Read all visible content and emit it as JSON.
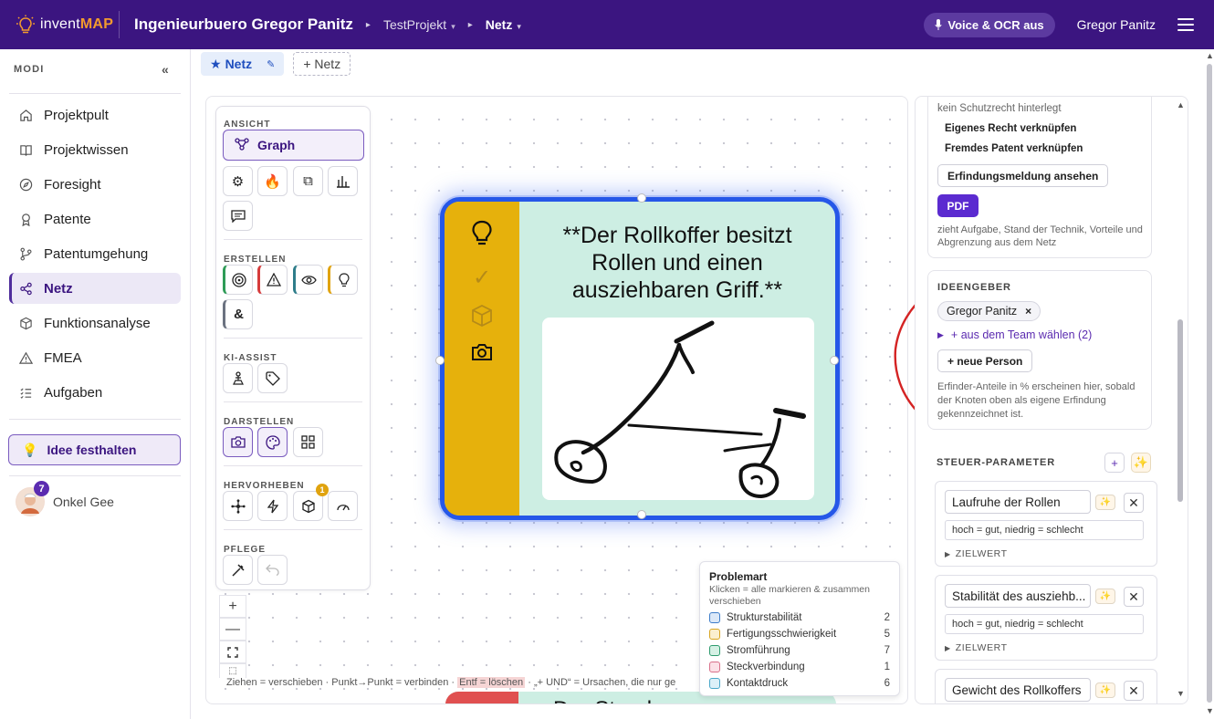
{
  "topbar": {
    "brand_prefix": "invent",
    "brand_suffix": "MAP",
    "org": "Ingenieurbuero Gregor Panitz",
    "crumbs": [
      "TestProjekt",
      "Netz"
    ],
    "voice_label": "Voice & OCR aus",
    "user": "Gregor Panitz"
  },
  "sidebar": {
    "section_label": "MODI",
    "collapse_glyph": "«",
    "items": [
      {
        "label": "Projektpult",
        "icon": "home-icon"
      },
      {
        "label": "Projektwissen",
        "icon": "book-icon"
      },
      {
        "label": "Foresight",
        "icon": "compass-icon"
      },
      {
        "label": "Patente",
        "icon": "award-icon"
      },
      {
        "label": "Patentumgehung",
        "icon": "branch-icon"
      },
      {
        "label": "Netz",
        "icon": "share-icon",
        "active": true
      },
      {
        "label": "Funktionsanalyse",
        "icon": "cube-icon"
      },
      {
        "label": "FMEA",
        "icon": "warning-icon"
      },
      {
        "label": "Aufgaben",
        "icon": "list-icon"
      }
    ],
    "idea_button": "Idee festhalten",
    "account_name": "Onkel Gee",
    "account_badge": "7"
  },
  "tabs": {
    "active": "Netz",
    "add": "+ Netz"
  },
  "toolpanel": {
    "ansicht": "ANSICHT",
    "graph": "Graph",
    "erstellen": "ERSTELLEN",
    "ampersand": "&",
    "ki_assist": "KI-ASSIST",
    "darstellen": "DARSTELLEN",
    "hervorheben": "HERVORHEBEN",
    "hervorheben_badge": "1",
    "pflege": "PFLEGE"
  },
  "node": {
    "title": "**Der Rollkoffer besitzt Rollen und einen ausziehbaren Griff.**",
    "check": "✓"
  },
  "node2": {
    "text": "Der Stand..."
  },
  "hint": {
    "part1": "Ziehen = verschieben · Punkt→Punkt = verbinden · ",
    "del": "Entf = löschen",
    "part2": " · „+ UND“ = Ursachen, die nur ge"
  },
  "legend": {
    "title": "Problemart",
    "subtitle": "Klicken = alle markieren & zusammen verschieben",
    "rows": [
      {
        "label": "Strukturstabilität",
        "count": "2",
        "color": "#3d7cc9",
        "fill": "#dbe8f8"
      },
      {
        "label": "Fertigungsschwierigkeit",
        "count": "5",
        "color": "#d9a521",
        "fill": "#fbefcf"
      },
      {
        "label": "Stromführung",
        "count": "7",
        "color": "#2e9b6e",
        "fill": "#d6f1e5"
      },
      {
        "label": "Steckverbindung",
        "count": "1",
        "color": "#d9708a",
        "fill": "#fbe1e7"
      },
      {
        "label": "Kontaktdruck",
        "count": "6",
        "color": "#4aa7c9",
        "fill": "#dcf0f8"
      }
    ]
  },
  "right": {
    "schutzrecht": "kein Schutzrecht hinterlegt",
    "eigenes": "Eigenes Recht verknüpfen",
    "fremdes": "Fremdes Patent verknüpfen",
    "meldung": "Erfindungsmeldung ansehen",
    "pdf": "PDF",
    "pdf_note": "zieht Aufgabe, Stand der Technik, Vorteile und Abgrenzung aus dem Netz",
    "ideengeber": "IDEENGEBER",
    "chip": "Gregor Panitz",
    "chip_x": "×",
    "team": "+ aus dem Team wählen (2)",
    "neue_person": "+ neue Person",
    "anteile": "Erfinder-Anteile in % erscheinen hier, sobald der Knoten oben als eigene Erfindung gekennzeichnet ist.",
    "steuer": "STEUER-PARAMETER",
    "params": [
      {
        "name": "Laufruhe der Rollen",
        "hint": "hoch = gut, niedrig = schlecht",
        "ziel": "ZIELWERT"
      },
      {
        "name": "Stabilität des ausziehb...",
        "hint": "hoch = gut, niedrig = schlecht",
        "ziel": "ZIELWERT"
      },
      {
        "name": "Gewicht des Rollkoffers"
      }
    ]
  }
}
